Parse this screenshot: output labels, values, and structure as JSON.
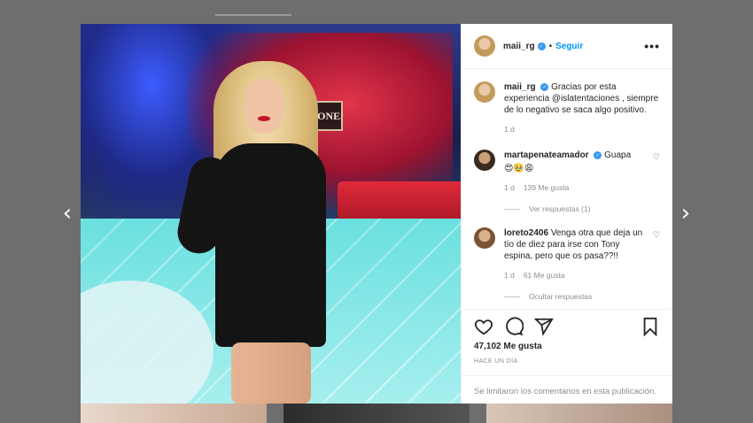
{
  "post": {
    "username": "maii_rg",
    "follow_label": "Seguir",
    "dot": "•",
    "more_label": "•••",
    "photo_sign": "TACIONES",
    "caption": {
      "username": "maii_rg",
      "text": "Gracias por esta experiencia @islatentaciones , siempre de lo negativo se saca algo positivo.",
      "time": "1 d"
    },
    "comments": [
      {
        "username": "martapenateamador",
        "text": "Guapa",
        "emojis": "😍🥹😩",
        "time": "1 d",
        "likes": "139 Me gusta",
        "replies_label": "Ver respuestas (1)"
      },
      {
        "username": "loreto2406",
        "text": "Venga otra que deja un tío de diez para irse con Tony espina, pero que os pasa??!!",
        "time": "1 d",
        "likes": "61 Me gusta",
        "replies_label": "Ocultar respuestas"
      }
    ],
    "likes_count": "47,102 Me gusta",
    "time_ago": "HACE UN DÍA",
    "comments_limited": "Se limitaron los comentarios en esta publicación."
  },
  "navigation": {
    "prev": "‹",
    "next": "›"
  },
  "icons": [
    "heart-icon",
    "comment-icon",
    "share-icon",
    "bookmark-icon",
    "verified-icon",
    "more-icon"
  ],
  "colors": {
    "accent": "#0095f6",
    "verified": "#3897f0",
    "muted": "#8e8e8e",
    "overlay": "#6e6e6e"
  }
}
